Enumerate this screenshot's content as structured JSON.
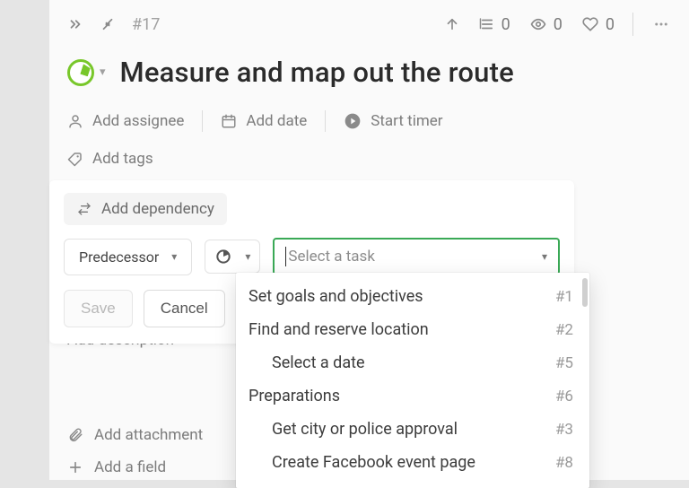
{
  "topbar": {
    "task_number": "#17",
    "subtasks_count": "0",
    "watchers_count": "0",
    "likes_count": "0"
  },
  "title": "Measure and map out the route",
  "meta": {
    "assignee_label": "Add assignee",
    "date_label": "Add date",
    "timer_label": "Start timer"
  },
  "tags": {
    "add_tags_label": "Add tags"
  },
  "dependency": {
    "header_label": "Add dependency",
    "type_label": "Predecessor",
    "select_placeholder": "Select a task",
    "save_label": "Save",
    "cancel_label": "Cancel"
  },
  "under": {
    "description_label": "Add description",
    "attachment_label": "Add attachment",
    "add_field_label": "Add a field"
  },
  "dropdown": {
    "items": [
      {
        "label": "Set goals and objectives",
        "num": "#1",
        "child": false
      },
      {
        "label": "Find and reserve location",
        "num": "#2",
        "child": false
      },
      {
        "label": "Select a date",
        "num": "#5",
        "child": true
      },
      {
        "label": "Preparations",
        "num": "#6",
        "child": false
      },
      {
        "label": "Get city or police approval",
        "num": "#3",
        "child": true
      },
      {
        "label": "Create Facebook event page",
        "num": "#8",
        "child": true
      }
    ]
  }
}
